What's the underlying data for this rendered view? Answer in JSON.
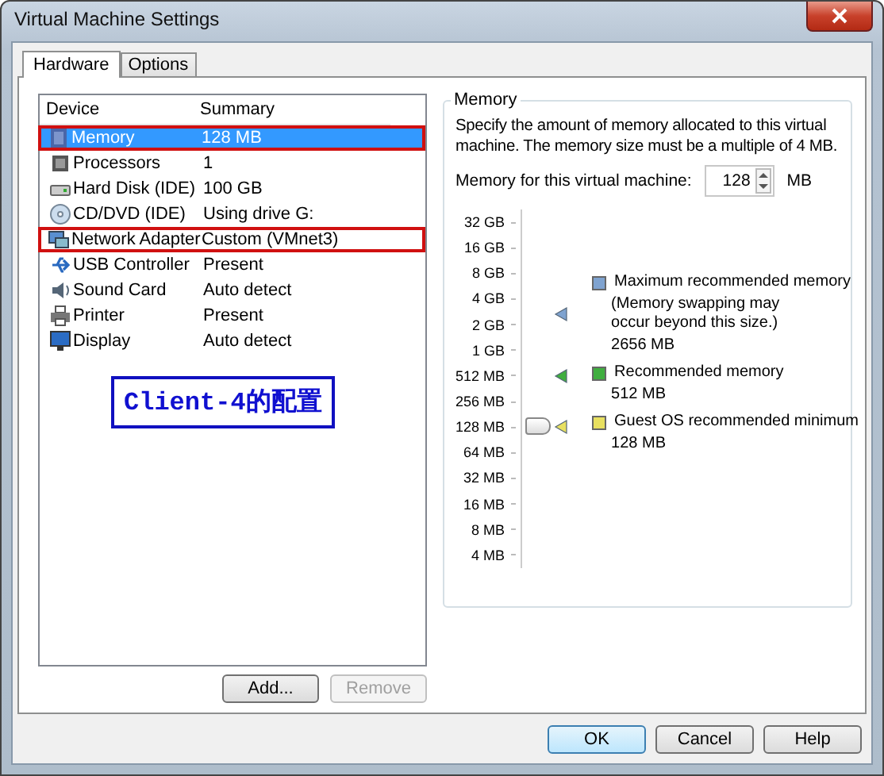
{
  "window": {
    "title": "Virtual Machine Settings"
  },
  "tabs": [
    {
      "label": "Hardware",
      "selected": true
    },
    {
      "label": "Options",
      "selected": false
    }
  ],
  "device_list": {
    "columns": [
      "Device",
      "Summary"
    ],
    "rows": [
      {
        "kind": "memory",
        "device": "Memory",
        "summary": "128 MB",
        "selected": true,
        "annotated": true
      },
      {
        "kind": "processor",
        "device": "Processors",
        "summary": "1",
        "selected": false,
        "annotated": false
      },
      {
        "kind": "disk",
        "device": "Hard Disk (IDE)",
        "summary": "100 GB",
        "selected": false,
        "annotated": false
      },
      {
        "kind": "cdrom",
        "device": "CD/DVD (IDE)",
        "summary": "Using drive G:",
        "selected": false,
        "annotated": false
      },
      {
        "kind": "network",
        "device": "Network Adapter",
        "summary": "Custom (VMnet3)",
        "selected": false,
        "annotated": true
      },
      {
        "kind": "usb",
        "device": "USB Controller",
        "summary": "Present",
        "selected": false,
        "annotated": false
      },
      {
        "kind": "sound",
        "device": "Sound Card",
        "summary": "Auto detect",
        "selected": false,
        "annotated": false
      },
      {
        "kind": "printer",
        "device": "Printer",
        "summary": "Present",
        "selected": false,
        "annotated": false
      },
      {
        "kind": "display",
        "device": "Display",
        "summary": "Auto detect",
        "selected": false,
        "annotated": false
      }
    ],
    "annotation": "Client-4的配置",
    "buttons": [
      {
        "label": "Add...",
        "disabled": false
      },
      {
        "label": "Remove",
        "disabled": true
      }
    ]
  },
  "memory": {
    "title": "Memory",
    "description": "Specify the amount of memory allocated to this virtual machine. The memory size must be a multiple of 4 MB.",
    "field_label": "Memory for this virtual machine:",
    "value": "128",
    "unit": "MB",
    "scale": [
      "32 GB",
      "16 GB",
      "8 GB",
      "4 GB",
      "2 GB",
      "1 GB",
      "512 MB",
      "256 MB",
      "128 MB",
      "64 MB",
      "32 MB",
      "16 MB",
      "8 MB",
      "4 MB"
    ],
    "slider": {
      "level": 0.385
    },
    "legend": [
      {
        "color": "#7fa3d0",
        "title": "Maximum recommended memory",
        "note": "(Memory swapping may occur beyond this size.)",
        "value": "2656 MB",
        "level": 0.724
      },
      {
        "color": "#3fae3f",
        "title": "Recommended memory",
        "value": "512 MB",
        "level": 0.538
      },
      {
        "color": "#e8e060",
        "title": "Guest OS recommended minimum",
        "value": "128 MB",
        "level": 0.386
      }
    ]
  },
  "dialog_buttons": [
    {
      "label": "OK",
      "default": true
    },
    {
      "label": "Cancel",
      "default": false
    },
    {
      "label": "Help",
      "default": false
    }
  ]
}
